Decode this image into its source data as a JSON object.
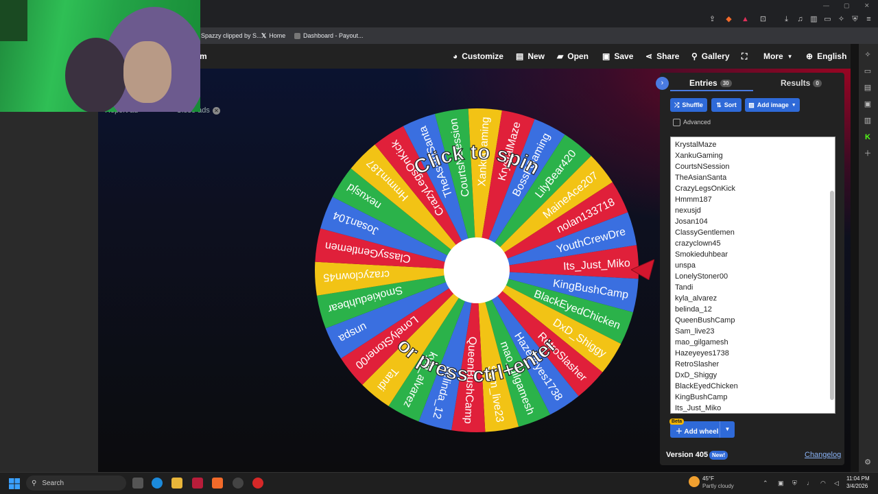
{
  "bookmarks": [
    {
      "label": "Spazzy clipped by S...",
      "icon": "clip-icon"
    },
    {
      "label": "Home",
      "icon": "x-logo-icon"
    },
    {
      "label": "Dashboard - Payout...",
      "icon": "dashboard-icon"
    }
  ],
  "nav": {
    "brand_tail": "m",
    "customize": "Customize",
    "new": "New",
    "open": "Open",
    "save": "Save",
    "share": "Share",
    "gallery": "Gallery",
    "more": "More",
    "language": "English"
  },
  "ads": {
    "report": "Report ad",
    "close": "Close ads"
  },
  "wheel": {
    "prompt_top": "Click to spin",
    "prompt_bottom": "or press ctrl+enter",
    "slices": [
      "Its_Just_Miko",
      "KingBushCamp",
      "BlackEyedChicken",
      "DxD_Shiggy",
      "RetroSlasher",
      "Hazeyeyes1738",
      "mao_gilgamesh",
      "Sam_live23",
      "QueenBushCamp",
      "belinda_12",
      "kyla_alvarez",
      "Tandi",
      "LonelyStoner00",
      "unspa",
      "Smokieduhbear",
      "crazyclown45",
      "ClassyGentlemen",
      "Josan104",
      "nexusjd",
      "Hmmm187",
      "CrazyLegsOnKick",
      "TheAsianSanta",
      "CourtsNSession",
      "XankuGaming",
      "KrystalMaze",
      "BossFGaming",
      "LilyBear420",
      "MaineAce207",
      "nolan133718",
      "YouthCrewDre"
    ],
    "colors": [
      "#e0203a",
      "#3a6fe0",
      "#2bb24a",
      "#f2c315"
    ]
  },
  "panel": {
    "tab_entries": "Entries",
    "entries_count": "30",
    "tab_results": "Results",
    "results_count": "0",
    "shuffle": "Shuffle",
    "sort": "Sort",
    "add_image": "Add image",
    "advanced": "Advanced",
    "entries": [
      "KrystalMaze",
      "XankuGaming",
      "CourtsNSession",
      "TheAsianSanta",
      "CrazyLegsOnKick",
      "Hmmm187",
      "nexusjd",
      "Josan104",
      "ClassyGentlemen",
      "crazyclown45",
      "Smokieduhbear",
      "unspa",
      "LonelyStoner00",
      "Tandi",
      "kyla_alvarez",
      "belinda_12",
      "QueenBushCamp",
      "Sam_live23",
      "mao_gilgamesh",
      "Hazeyeyes1738",
      "RetroSlasher",
      "DxD_Shiggy",
      "BlackEyedChicken",
      "KingBushCamp",
      "Its_Just_Miko"
    ],
    "beta": "Beta",
    "add_wheel": "Add wheel",
    "version": "Version 405",
    "new_badge": "New!",
    "changelog": "Changelog"
  },
  "taskbar": {
    "search": "Search",
    "weather_temp": "45°F",
    "weather_desc": "Partly cloudy",
    "time": "11:04 PM",
    "date": "3/4/2026"
  }
}
